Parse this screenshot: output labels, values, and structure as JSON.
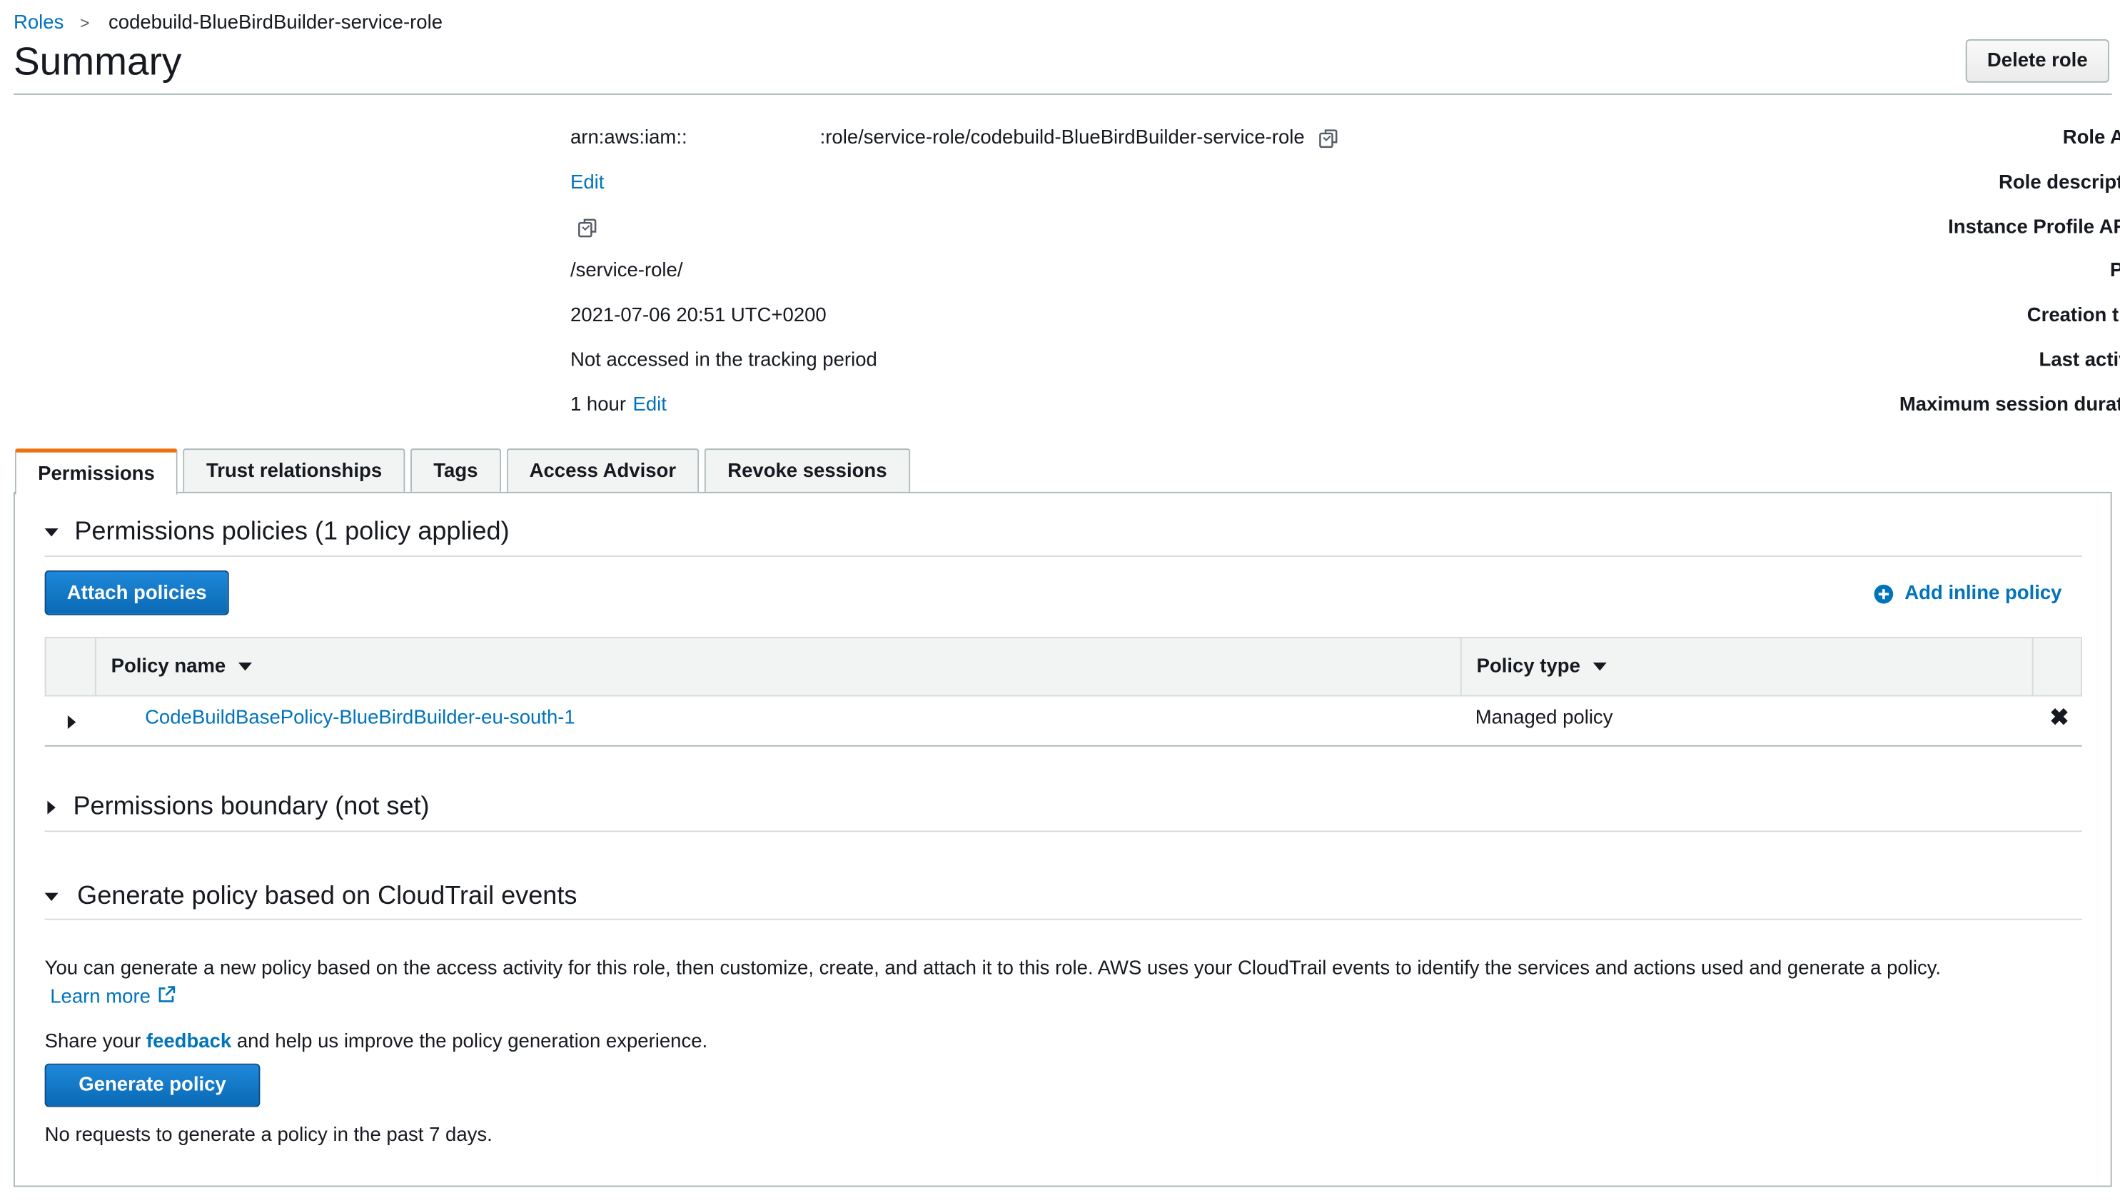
{
  "breadcrumb": {
    "parent": "Roles",
    "separator": ">",
    "current": "codebuild-BlueBirdBuilder-service-role"
  },
  "header": {
    "title": "Summary",
    "delete_label": "Delete role"
  },
  "summary": {
    "role_arn": {
      "label": "Role ARN",
      "value_prefix": "arn:aws:iam::",
      "value_suffix": ":role/service-role/codebuild-BlueBirdBuilder-service-role"
    },
    "role_description": {
      "label": "Role description",
      "edit": "Edit"
    },
    "instance_profile_arns": {
      "label": "Instance Profile ARNs"
    },
    "path": {
      "label": "Path",
      "value": "/service-role/"
    },
    "creation_time": {
      "label": "Creation time",
      "value": "2021-07-06 20:51 UTC+0200"
    },
    "last_activity": {
      "label": "Last activity",
      "value": "Not accessed in the tracking period"
    },
    "max_session": {
      "label": "Maximum session duration",
      "value": "1 hour",
      "edit": "Edit"
    }
  },
  "tabs": [
    {
      "label": "Permissions",
      "active": true
    },
    {
      "label": "Trust relationships"
    },
    {
      "label": "Tags"
    },
    {
      "label": "Access Advisor"
    },
    {
      "label": "Revoke sessions"
    }
  ],
  "permissions": {
    "policies_heading": "Permissions policies (1 policy applied)",
    "attach_label": "Attach policies",
    "add_inline_label": "Add inline policy",
    "columns": {
      "name": "Policy name",
      "type": "Policy type"
    },
    "rows": [
      {
        "name": "CodeBuildBasePolicy-BlueBirdBuilder-eu-south-1",
        "type": "Managed policy",
        "remove": "✖"
      }
    ],
    "boundary_heading": "Permissions boundary (not set)",
    "generate_heading": "Generate policy based on CloudTrail events",
    "generate_text": "You can generate a new policy based on the access activity for this role, then customize, create, and attach it to this role. AWS uses your CloudTrail events to identify the services and actions used and generate a policy.",
    "learn_more": "Learn more",
    "feedback_prefix": "Share your",
    "feedback_link": "feedback",
    "feedback_suffix": "and help us improve the policy generation experience.",
    "generate_label": "Generate policy",
    "no_requests": "No requests to generate a policy in the past 7 days."
  },
  "colors": {
    "link": "#0073bb",
    "primary": "#0a6ab6",
    "tab_accent": "#ec7211"
  },
  "icons": [
    "copy-icon",
    "plus-circle-icon",
    "external-link-icon",
    "close-icon",
    "caret-down-icon",
    "caret-right-icon"
  ]
}
